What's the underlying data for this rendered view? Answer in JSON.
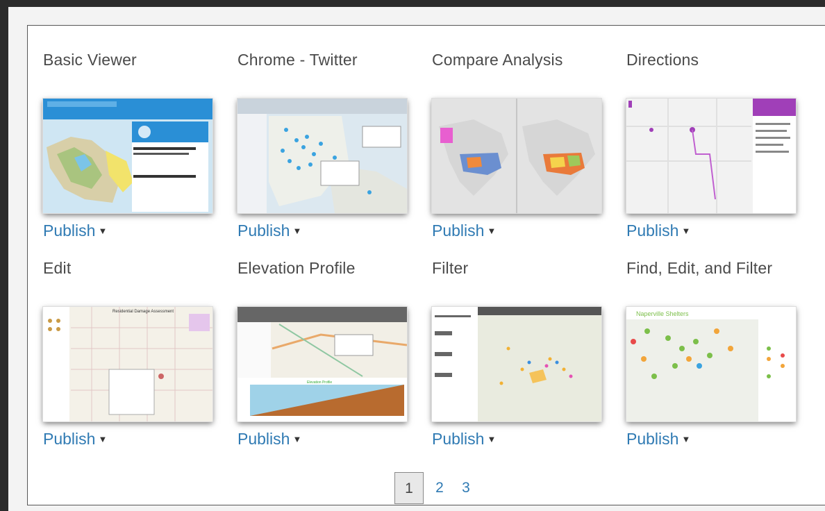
{
  "gallery": {
    "items": [
      {
        "title": "Basic Viewer",
        "publish_label": "Publish",
        "caret": "▼",
        "thumbnail": "map-thumbnail-basic-viewer"
      },
      {
        "title": "Chrome - Twitter",
        "publish_label": "Publish",
        "caret": "▼",
        "thumbnail": "map-thumbnail-chrome-twitter"
      },
      {
        "title": "Compare Analysis",
        "publish_label": "Publish",
        "caret": "▼",
        "thumbnail": "map-thumbnail-compare-analysis"
      },
      {
        "title": "Directions",
        "publish_label": "Publish",
        "caret": "▼",
        "thumbnail": "map-thumbnail-directions"
      },
      {
        "title": "Edit",
        "publish_label": "Publish",
        "caret": "▼",
        "thumbnail": "map-thumbnail-edit"
      },
      {
        "title": "Elevation Profile",
        "publish_label": "Publish",
        "caret": "▼",
        "thumbnail": "map-thumbnail-elevation-profile"
      },
      {
        "title": "Filter",
        "publish_label": "Publish",
        "caret": "▼",
        "thumbnail": "map-thumbnail-filter"
      },
      {
        "title": "Find, Edit, and Filter",
        "publish_label": "Publish",
        "caret": "▼",
        "thumbnail": "map-thumbnail-find-edit-filter"
      }
    ]
  },
  "pagination": {
    "pages": [
      "1",
      "2",
      "3"
    ],
    "current": "1"
  },
  "colors": {
    "link": "#2f7ab3",
    "title_text": "#4a4a4a",
    "border": "#555555"
  }
}
